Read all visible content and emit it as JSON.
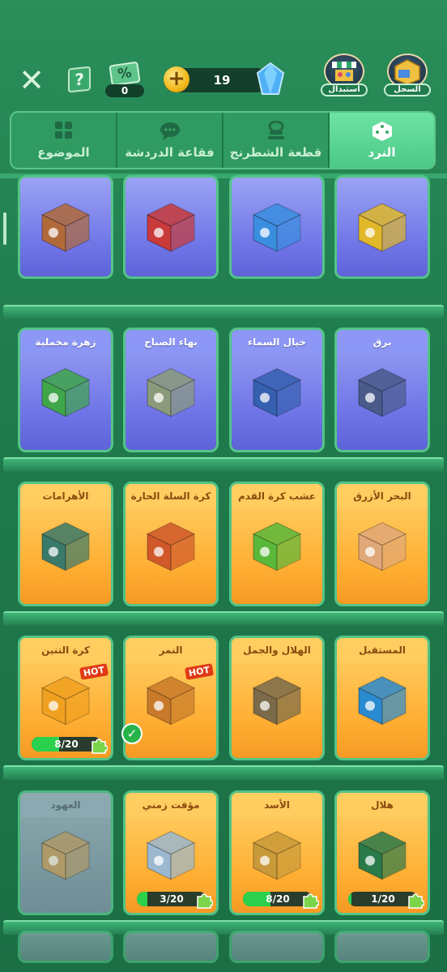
{
  "header": {
    "discount_count": "0",
    "coins": "19",
    "exchange_label": "استبدال",
    "record_label": "السجل",
    "help_glyph": "?",
    "discount_glyph": "%",
    "plus_glyph": "+"
  },
  "tabs": [
    {
      "label": "الموضوع",
      "icon": "grid-icon"
    },
    {
      "label": "فقاعة الدردشة",
      "icon": "chat-bubble-icon"
    },
    {
      "label": "قطعة الشطرنج",
      "icon": "chess-piece-icon"
    },
    {
      "label": "النرد",
      "icon": "dice-icon"
    }
  ],
  "rows": [
    {
      "cards": [
        {
          "title": "",
          "theme": "purple",
          "dice_color": "#b06a3a"
        },
        {
          "title": "",
          "theme": "purple",
          "dice_color": "#c93a3a"
        },
        {
          "title": "",
          "theme": "purple",
          "dice_color": "#3a8ee0"
        },
        {
          "title": "",
          "theme": "purple",
          "dice_color": "#e0b82a"
        }
      ]
    },
    {
      "cards": [
        {
          "title": "زهرة مخملية",
          "theme": "purple",
          "dice_color": "#3fa64a"
        },
        {
          "title": "بهاء الصباح",
          "theme": "purple",
          "dice_color": "#8a9a7a"
        },
        {
          "title": "خيال السماء",
          "theme": "purple",
          "dice_color": "#3560b0"
        },
        {
          "title": "برق",
          "theme": "purple",
          "dice_color": "#4a5a8a"
        }
      ]
    },
    {
      "cards": [
        {
          "title": "الأهرامات",
          "theme": "orange",
          "dice_color": "#3a7a6a"
        },
        {
          "title": "كرة السلة الحارة",
          "theme": "orange",
          "dice_color": "#d0582a"
        },
        {
          "title": "عشب كرة القدم",
          "theme": "orange",
          "dice_color": "#5ab83a"
        },
        {
          "title": "البحر الأزرق",
          "theme": "orange",
          "dice_color": "#e0a878"
        }
      ]
    },
    {
      "cards": [
        {
          "title": "كرة التنين",
          "theme": "orange",
          "dice_color": "#f0a020",
          "hot": "HOT",
          "progress_text": "8/20",
          "progress": 0.4
        },
        {
          "title": "النمر",
          "theme": "orange",
          "dice_color": "#c87a2a",
          "hot": "HOT",
          "owned": true
        },
        {
          "title": "الهلال والجمل",
          "theme": "orange",
          "dice_color": "#7a6a4a"
        },
        {
          "title": "المستقبل",
          "theme": "orange",
          "dice_color": "#2a8ad0"
        }
      ]
    },
    {
      "cards": [
        {
          "title": "العهود",
          "theme": "gray",
          "dice_color": "#c8a070"
        },
        {
          "title": "مؤقت زمني",
          "theme": "orange",
          "dice_color": "#9ab8d0",
          "progress_text": "3/20",
          "progress": 0.15
        },
        {
          "title": "الأسد",
          "theme": "orange",
          "dice_color": "#c89a3a",
          "progress_text": "8/20",
          "progress": 0.4
        },
        {
          "title": "هلال",
          "theme": "orange",
          "dice_color": "#2a7a4a",
          "progress_text": "1/20",
          "progress": 0.05
        }
      ]
    }
  ],
  "check_glyph": "✓"
}
